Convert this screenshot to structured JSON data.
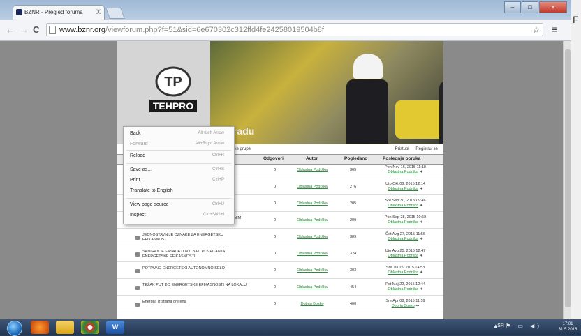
{
  "browser": {
    "tab_title": "BZNR - Pregled foruma",
    "tab_close": "X",
    "url_host": "www.bznr.org",
    "url_path": "/viewforum.php?f=51&sid=6e670302c312ffd4fe24258019504b8f",
    "back_label": "←",
    "forward_label": "→",
    "reload_label": "C",
    "star_label": "☆",
    "menu_label": "≡",
    "win_min": "–",
    "win_max": "□",
    "win_close": "x"
  },
  "page": {
    "banner_heading": "radu",
    "logo_text": "TEHPRO",
    "logo_mark": "TP",
    "topbar_left": "tke grupe",
    "topbar_links": [
      "Pristupi",
      "Registruj se"
    ]
  },
  "table": {
    "headers": [
      "Odgovori",
      "Autor",
      "Pogledano",
      "Poslednja poruka"
    ],
    "rows": [
      {
        "topic": "...ERGETSKE",
        "replies": "0",
        "author": "Oblastna Podrška",
        "views": "365",
        "last_date": "Pon Nov 16, 2015 11:18",
        "last_author": "Oblastna Podrška"
      },
      {
        "topic": "...SLAN",
        "replies": "0",
        "author": "Oblastna Podrška",
        "views": "276",
        "last_date": "Uto Okt 06, 2015 12:14",
        "last_author": "Oblastna Podrška"
      },
      {
        "topic": "...ODŽEBA",
        "replies": "0",
        "author": "Oblastna Podrška",
        "views": "205",
        "last_date": "Sre Sep 30, 2015 09:46",
        "last_author": "Oblastna Podrška"
      },
      {
        "topic": "MOGUĆE VELIKE UŠTEDE ENERGIJE U PORODIČNIM OBJEKTIMA",
        "replies": "0",
        "author": "Oblastna Podrška",
        "views": "209",
        "last_date": "Pon Sep 28, 2015 10:58",
        "last_author": "Oblastna Podrška"
      },
      {
        "topic": "JEDNOSTAVNIJE OZNAKE ZA ENERGETSKU EFIKASNOST",
        "replies": "0",
        "author": "Oblastna Podrška",
        "views": "389",
        "last_date": "Čet Avg 27, 2015 11:56",
        "last_author": "Oblastna Podrška"
      },
      {
        "topic": "SANIRANJE FASADA U 800 BATI POVEĆANJA ENERGETSKE EFIKASNOSTI",
        "replies": "0",
        "author": "Oblastna Podrška",
        "views": "324",
        "last_date": "Uto Avg 25, 2015 12:47",
        "last_author": "Oblastna Podrška"
      },
      {
        "topic": "POTPUNO ENERGETSKI AUTONOMNO SELO",
        "replies": "0",
        "author": "Oblastna Podrška",
        "views": "393",
        "last_date": "Sre Jul 15, 2015 14:53",
        "last_author": "Oblastna Podrška"
      },
      {
        "topic": "TEŽAK PUT DO ENERGETSKE EFIKASNOSTI NA LOKALU",
        "replies": "0",
        "author": "Oblastna Podrška",
        "views": "454",
        "last_date": "Pet Maj 22, 2015 12:44",
        "last_author": "Oblastna Podrška"
      },
      {
        "topic": "Energija iz straha grefena",
        "replies": "0",
        "author": "Dobrin Bosko",
        "views": "400",
        "last_date": "Sre Apr 08, 2015 11:59",
        "last_author": "Dobrin Bosko"
      }
    ]
  },
  "context_menu": {
    "items": [
      {
        "label": "Back",
        "shortcut": "Alt+Left Arrow",
        "enabled": true
      },
      {
        "label": "Forward",
        "shortcut": "Alt+Right Arrow",
        "enabled": false
      },
      {
        "label": "Reload",
        "shortcut": "Ctrl+R",
        "enabled": true
      },
      {
        "label": "Save as...",
        "shortcut": "Ctrl+S",
        "enabled": true
      },
      {
        "label": "Print...",
        "shortcut": "Ctrl+P",
        "enabled": true
      },
      {
        "label": "Translate to English",
        "shortcut": "",
        "enabled": true
      },
      {
        "label": "View page source",
        "shortcut": "Ctrl+U",
        "enabled": true
      },
      {
        "label": "Inspect",
        "shortcut": "Ctrl+Shift+I",
        "enabled": true
      }
    ]
  },
  "taskbar": {
    "language": "SR",
    "tray_icons": "▲ ⚑ ▭ ◀)",
    "time": "17:01",
    "date": "31.5.2016"
  }
}
